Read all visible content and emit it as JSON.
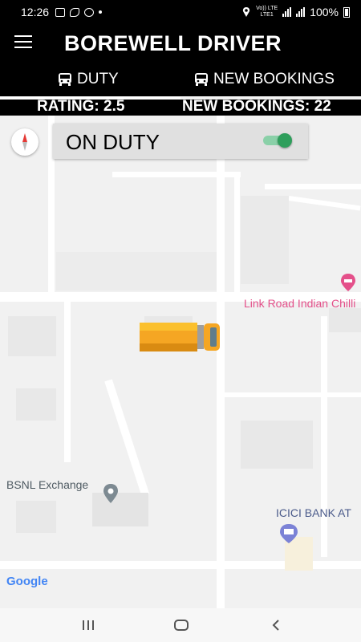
{
  "status": {
    "time": "12:26",
    "network": "Vo)) LTE",
    "lte": "LTE1",
    "battery": "100%"
  },
  "app": {
    "title": "BOREWELL DRIVER"
  },
  "tabs": [
    {
      "label": "DUTY",
      "icon": "bus-icon",
      "selected": true
    },
    {
      "label": "NEW BOOKINGS",
      "icon": "bus-icon",
      "selected": false
    }
  ],
  "stats": {
    "rating": "RATING: 2.5",
    "new_bookings": "NEW BOOKINGS: 22"
  },
  "duty": {
    "label": "ON DUTY",
    "on": true
  },
  "map": {
    "places": [
      {
        "name": "Link Road Indian Chilli",
        "icon": "restaurant-pin-icon",
        "color": "#e4508a"
      },
      {
        "name": "BSNL Exchange",
        "icon": "location-pin-icon",
        "color": "#5f6b73"
      },
      {
        "name": "ICICI BANK AT",
        "icon": "atm-pin-icon",
        "color": "#7b82d6"
      }
    ],
    "attribution": "Google",
    "vehicle": "truck-icon"
  },
  "colors": {
    "appbar": "#000000",
    "toggle_on": "#2e9e5b",
    "map_bg": "#f1f1f1"
  }
}
